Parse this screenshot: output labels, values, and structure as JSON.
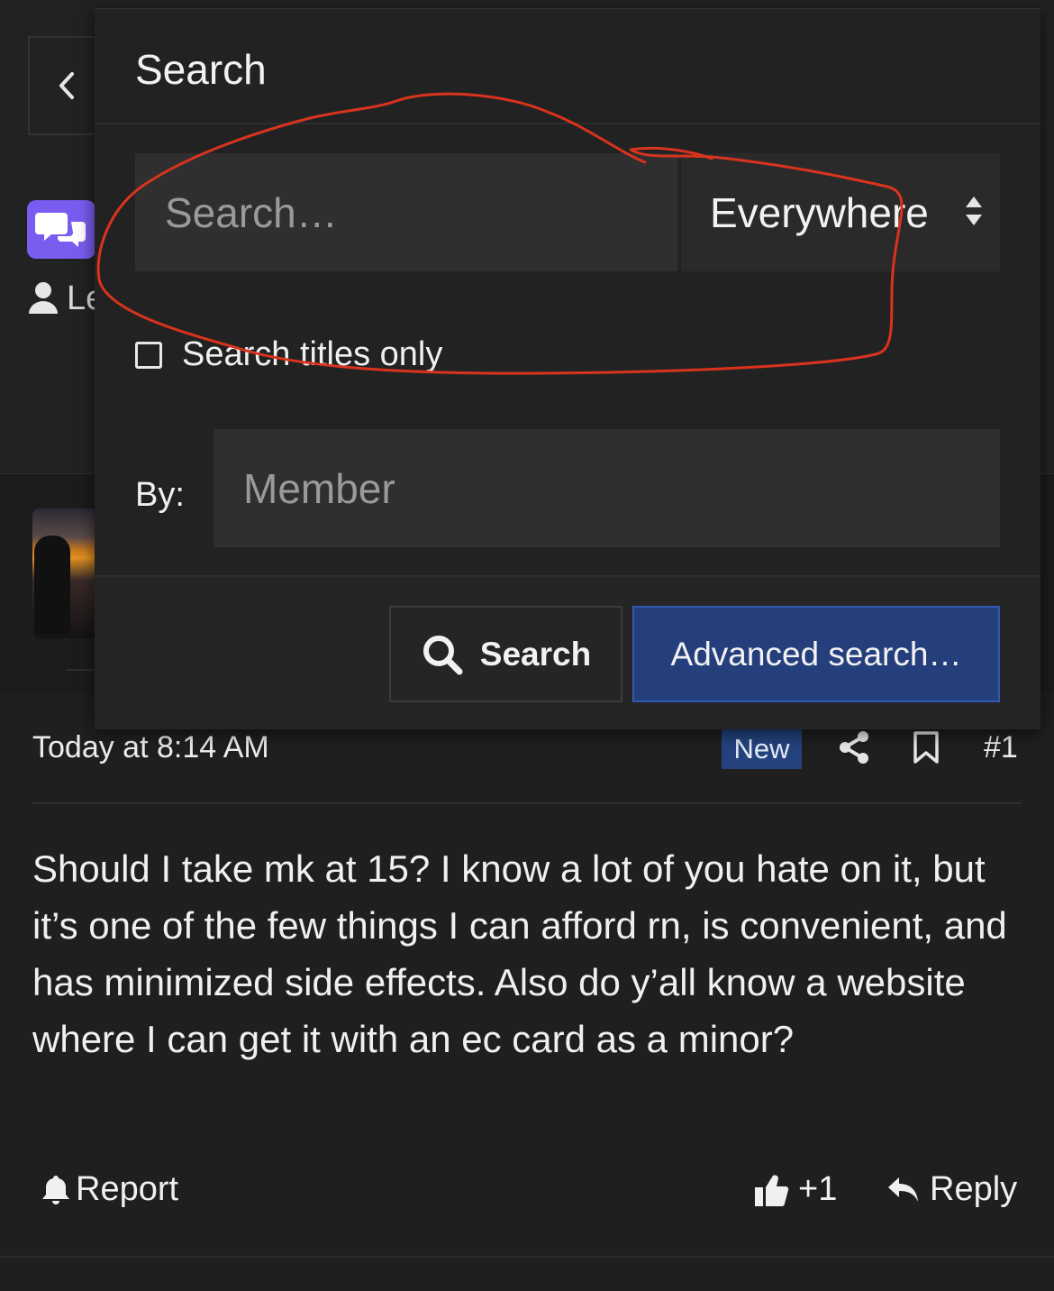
{
  "colors": {
    "accent": "#253e7c",
    "badge": "#23427e",
    "forum_icon_bg": "#7a5cf0",
    "annotation": "#d9331e"
  },
  "background": {
    "user_label": "Le"
  },
  "search_menu": {
    "title": "Search",
    "search_placeholder": "Search…",
    "scope_value": "Everywhere",
    "titles_only_label": "Search titles only",
    "by_label": "By:",
    "member_placeholder": "Member",
    "search_button": "Search",
    "advanced_button": "Advanced search…"
  },
  "post": {
    "date": "Today at 8:14 AM",
    "badge": "New",
    "number": "#1",
    "body": "Should I take mk at 15? I know a lot of you hate on it, but it’s one of the few things I can afford rn, is convenient, and has minimized side effects. Also do y’all know a website where I can get it with an ec card as a minor?",
    "report_label": "Report",
    "like_label": "+1",
    "reply_label": "Reply"
  }
}
